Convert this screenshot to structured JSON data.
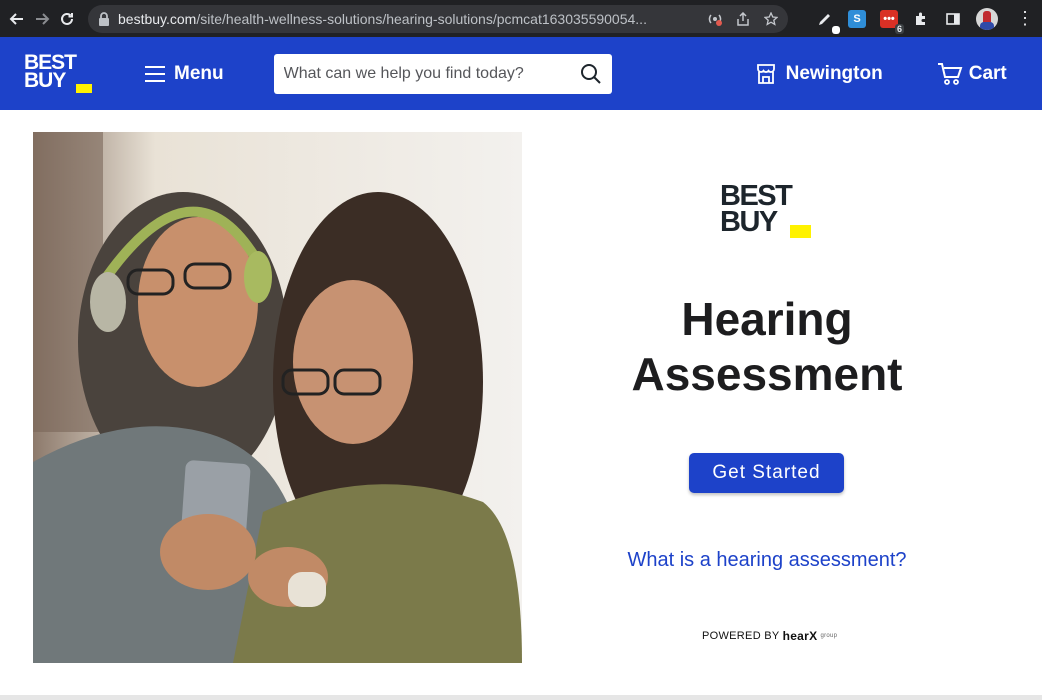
{
  "browser": {
    "url_host": "bestbuy.com",
    "url_path": "/site/health-wellness-solutions/hearing-solutions/pcmcat163035590054...",
    "extension_badge": "6"
  },
  "header": {
    "logo_line1": "BEST",
    "logo_line2": "BUY",
    "menu_label": "Menu",
    "search_placeholder": "What can we help you find today?",
    "store_label": "Newington",
    "cart_label": "Cart",
    "brand_color": "#1d42c9",
    "tag_color": "#fff200"
  },
  "hero": {
    "logo_line1": "BEST",
    "logo_line2": "BUY",
    "title_line1": "Hearing",
    "title_line2": "Assessment",
    "cta_label": "Get Started",
    "link_label": "What is a hearing assessment?",
    "powered_prefix": "POWERED BY",
    "powered_brand": "hearX",
    "powered_group": "group"
  }
}
